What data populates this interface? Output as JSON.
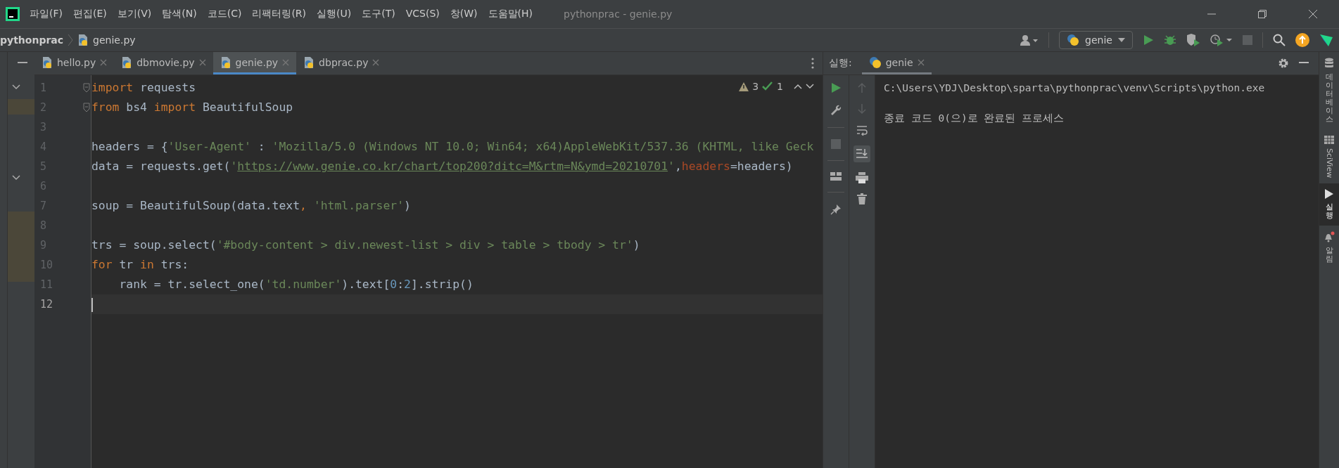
{
  "window": {
    "title": "pythonprac - genie.py"
  },
  "menu": [
    "파일(F)",
    "편집(E)",
    "보기(V)",
    "탐색(N)",
    "코드(C)",
    "리팩터링(R)",
    "실행(U)",
    "도구(T)",
    "VCS(S)",
    "창(W)",
    "도움말(H)"
  ],
  "breadcrumb": [
    "pythonprac",
    "genie.py"
  ],
  "run_config": {
    "label": "genie"
  },
  "editor_tabs": [
    {
      "label": "hello.py",
      "selected": false
    },
    {
      "label": "dbmovie.py",
      "selected": false
    },
    {
      "label": "genie.py",
      "selected": true
    },
    {
      "label": "dbprac.py",
      "selected": false
    }
  ],
  "inspections": {
    "warnings": "3",
    "weak_warnings": "1"
  },
  "code_lines": [
    {
      "number": "1",
      "current": false,
      "fold": true,
      "tokens": [
        {
          "kind": "keyword",
          "text": "import"
        },
        {
          "kind": "plain",
          "text": " requests"
        }
      ]
    },
    {
      "number": "2",
      "current": false,
      "fold": true,
      "tokens": [
        {
          "kind": "keyword",
          "text": "from"
        },
        {
          "kind": "plain",
          "text": " bs4 "
        },
        {
          "kind": "keyword",
          "text": "import"
        },
        {
          "kind": "plain",
          "text": " BeautifulSoup"
        }
      ]
    },
    {
      "number": "3",
      "current": false,
      "fold": false
    },
    {
      "number": "4",
      "current": false,
      "fold": false,
      "tokens": [
        {
          "kind": "plain",
          "text": "headers = {"
        },
        {
          "kind": "string",
          "text": "'User-Agent'"
        },
        {
          "kind": "plain",
          "text": " : "
        },
        {
          "kind": "string",
          "text": "'Mozilla/5.0 (Windows NT 10.0; Win64; x64)AppleWebKit/537.36 (KHTML, like Geck"
        }
      ]
    },
    {
      "number": "5",
      "current": false,
      "fold": false,
      "tokens": [
        {
          "kind": "plain",
          "text": "data = requests.get("
        },
        {
          "kind": "string",
          "text": "'"
        },
        {
          "kind": "link",
          "text": "https://www.genie.co.kr/chart/top200?ditc=M&rtm=N&ymd=20210701"
        },
        {
          "kind": "string",
          "text": "'"
        },
        {
          "kind": "plain",
          "text": ","
        },
        {
          "kind": "param",
          "text": "headers"
        },
        {
          "kind": "plain",
          "text": "=headers)"
        }
      ]
    },
    {
      "number": "6",
      "current": false,
      "fold": false
    },
    {
      "number": "7",
      "current": false,
      "fold": false,
      "tokens": [
        {
          "kind": "plain",
          "text": "soup = BeautifulSoup(data.text"
        },
        {
          "kind": "keyword",
          "text": ","
        },
        {
          "kind": "string",
          "text": " 'html.parser'"
        },
        {
          "kind": "plain",
          "text": ")"
        }
      ]
    },
    {
      "number": "8",
      "current": false,
      "fold": false
    },
    {
      "number": "9",
      "current": false,
      "fold": false,
      "tokens": [
        {
          "kind": "plain",
          "text": "trs = soup.select("
        },
        {
          "kind": "string",
          "text": "'#body-content > div.newest-list > div > table > tbody > tr'"
        },
        {
          "kind": "plain",
          "text": ")"
        }
      ]
    },
    {
      "number": "10",
      "current": false,
      "fold": false,
      "tokens": [
        {
          "kind": "keyword",
          "text": "for"
        },
        {
          "kind": "plain",
          "text": " tr "
        },
        {
          "kind": "keyword",
          "text": "in"
        },
        {
          "kind": "plain",
          "text": " trs:"
        }
      ]
    },
    {
      "number": "11",
      "current": false,
      "fold": false,
      "tokens": [
        {
          "kind": "plain",
          "text": "    rank = tr.select_one("
        },
        {
          "kind": "string",
          "text": "'td.number'"
        },
        {
          "kind": "plain",
          "text": ").text["
        },
        {
          "kind": "number",
          "text": "0"
        },
        {
          "kind": "plain",
          "text": ":"
        },
        {
          "kind": "number",
          "text": "2"
        },
        {
          "kind": "plain",
          "text": "].strip()"
        }
      ]
    },
    {
      "number": "12",
      "current": true,
      "fold": false
    }
  ],
  "run_panel": {
    "label": "실행:",
    "tabs": [
      {
        "label": "genie",
        "selected": true
      }
    ],
    "console": [
      "C:\\Users\\YDJ\\Desktop\\sparta\\pythonprac\\venv\\Scripts\\python.exe",
      "종료 코드 0(으)로 완료된 프로세스"
    ]
  },
  "right_sidebar": [
    {
      "label": "데이터베이스",
      "kind": "stacked",
      "selected": false
    },
    {
      "label": "SciView",
      "kind": "rotated",
      "selected": false
    },
    {
      "label": "실행",
      "kind": "stacked",
      "selected": true
    },
    {
      "label": "알림",
      "kind": "stacked",
      "selected": false
    }
  ]
}
